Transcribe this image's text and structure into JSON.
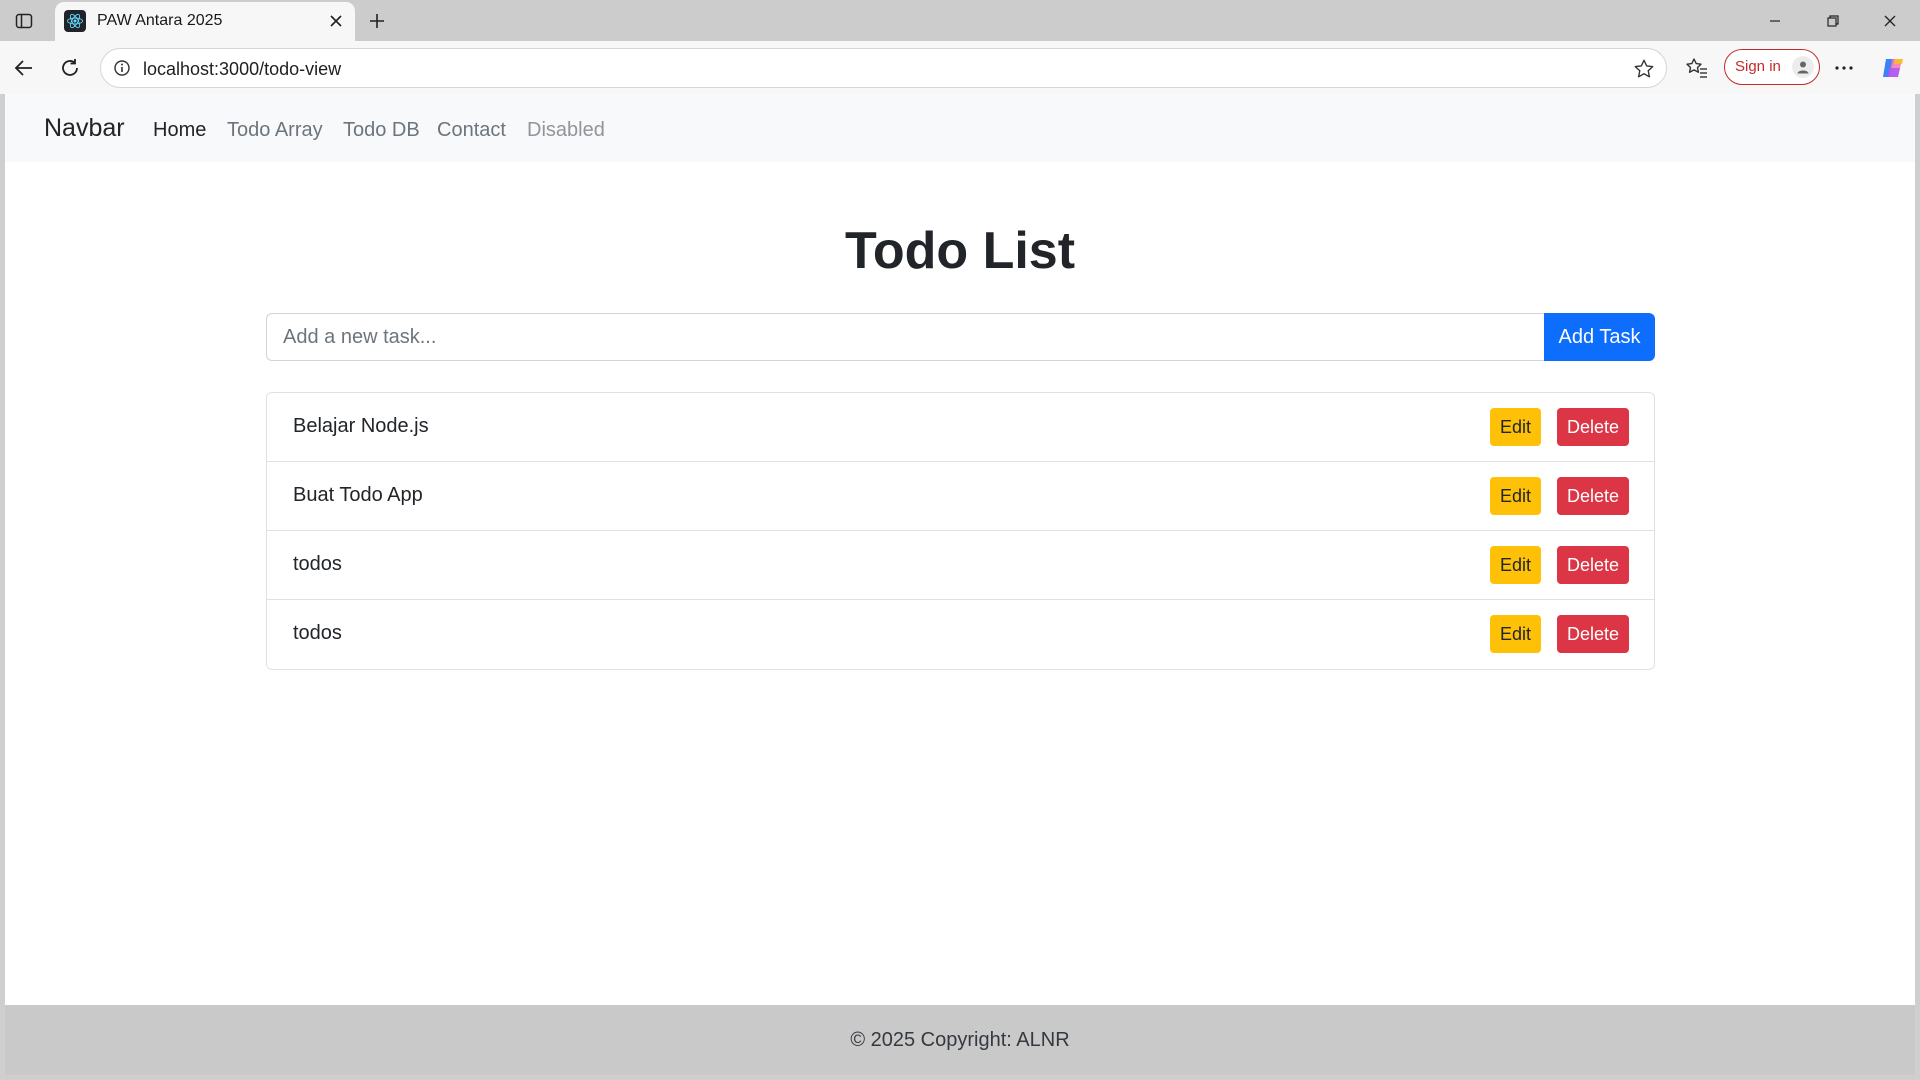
{
  "browser": {
    "tab_title": "PAW Antara 2025",
    "url": "localhost:3000/todo-view",
    "sign_in_label": "Sign in",
    "icons": [
      "sidebar-toggle-icon",
      "react-icon",
      "close-icon",
      "plus-icon",
      "minimize-icon",
      "restore-icon",
      "close-icon",
      "back-icon",
      "refresh-icon",
      "info-icon",
      "star-icon",
      "favorites-icon",
      "profile-icon",
      "more-icon",
      "copilot-icon"
    ]
  },
  "navbar": {
    "brand": "Navbar",
    "links": [
      {
        "label": "Home",
        "state": "active"
      },
      {
        "label": "Todo Array",
        "state": "normal"
      },
      {
        "label": "Todo DB",
        "state": "normal"
      },
      {
        "label": "Contact",
        "state": "normal"
      },
      {
        "label": "Disabled",
        "state": "disabled"
      }
    ]
  },
  "main": {
    "title": "Todo List",
    "input_placeholder": "Add a new task...",
    "input_value": "",
    "add_button": "Add Task"
  },
  "todos": [
    {
      "text": "Belajar Node.js",
      "edit": "Edit",
      "delete": "Delete"
    },
    {
      "text": "Buat Todo App",
      "edit": "Edit",
      "delete": "Delete"
    },
    {
      "text": "todos",
      "edit": "Edit",
      "delete": "Delete"
    },
    {
      "text": "todos",
      "edit": "Edit",
      "delete": "Delete"
    }
  ],
  "footer": {
    "text": "© 2025 Copyright: ALNR"
  },
  "colors": {
    "primary": "#0d6efd",
    "warning": "#ffc107",
    "danger": "#dc3545",
    "navbar_bg": "#f8f9fa",
    "footer_bg": "#c9c9c9"
  }
}
